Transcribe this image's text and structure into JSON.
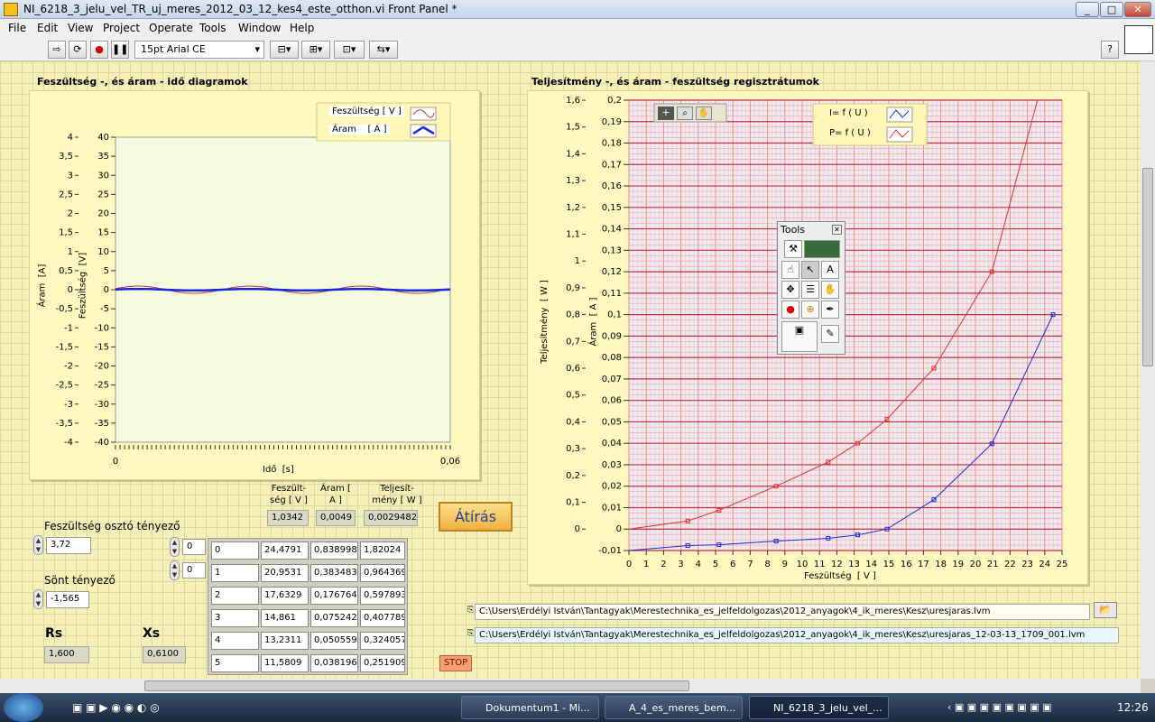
{
  "window": {
    "title": "NI_6218_3_jelu_vel_TR_uj_meres_2012_03_12_kes4_este_otthon.vi Front Panel *"
  },
  "menu": [
    "File",
    "Edit",
    "View",
    "Project",
    "Operate",
    "Tools",
    "Window",
    "Help"
  ],
  "toolbar": {
    "font": "15pt Arial CE",
    "help": "?"
  },
  "left_graph": {
    "title": "Feszültség -, és áram - idő diagramok",
    "legend": [
      "Feszültség [ V ]",
      "Áram    [ A ]"
    ],
    "y_left_label": "Áram  [A]",
    "y_right_label": "Feszültség  [V]",
    "x_label": "Idő  [s]",
    "y_left_ticks": [
      "4",
      "3,5",
      "3",
      "2,5",
      "2",
      "1,5",
      "1",
      "0,5",
      "0",
      "-0,5",
      "-1",
      "-1,5",
      "-2",
      "-2,5",
      "-3",
      "-3,5",
      "-4"
    ],
    "y_right_ticks": [
      "40",
      "35",
      "30",
      "25",
      "20",
      "15",
      "10",
      "5",
      "0",
      "-5",
      "-10",
      "-15",
      "-20",
      "-25",
      "-30",
      "-35",
      "-40"
    ],
    "x_ticks": [
      "0",
      "0,06"
    ]
  },
  "right_graph": {
    "title": "Teljesítmény -, és áram - feszültség regisztrátumok",
    "legend": [
      "I= f ( U )",
      "P= f ( U )"
    ],
    "y_left_label": "Teljesítmény  [ W ]",
    "y_right_label": "Áram  [ A ]",
    "x_label": "Feszültség  [ V ]",
    "p_ticks": [
      "1,6",
      "1,5",
      "1,4",
      "1,3",
      "1,2",
      "1,1",
      "1",
      "0,9",
      "0,8",
      "0,7",
      "0,6",
      "0,5",
      "0,4",
      "0,3",
      "0,2",
      "0,1",
      "0"
    ],
    "i_ticks": [
      "0,2",
      "0,19",
      "0,18",
      "0,17",
      "0,16",
      "0,15",
      "0,14",
      "0,13",
      "0,12",
      "0,11",
      "0,1",
      "0,09",
      "0,08",
      "0,07",
      "0,06",
      "0,05",
      "0,04",
      "0,03",
      "0,02",
      "0,01",
      "0",
      "-0,01"
    ],
    "x_ticks": [
      "0",
      "1",
      "2",
      "3",
      "4",
      "5",
      "6",
      "7",
      "8",
      "9",
      "10",
      "11",
      "12",
      "13",
      "14",
      "15",
      "16",
      "17",
      "18",
      "19",
      "20",
      "21",
      "22",
      "23",
      "24",
      "25"
    ]
  },
  "chart_data": {
    "type": "line",
    "title": "Teljesítmény -, és áram - feszültség regisztrátumok",
    "xlabel": "Feszültség  [ V ]",
    "ylabel": "Teljesítmény  [ W ]",
    "xlim": [
      0,
      25
    ],
    "series": [
      {
        "name": "I= f ( U )",
        "axis": "I",
        "color": "#1a2ad8",
        "x": [
          0,
          3.4,
          5.2,
          8.5,
          11.5,
          13.2,
          14.9,
          17.6,
          20.95,
          24.48
        ],
        "y": [
          -0.01,
          -0.0077,
          -0.0073,
          -0.0056,
          -0.0043,
          -0.0027,
          0.0,
          0.0137,
          0.0398,
          0.1
        ]
      },
      {
        "name": "P= f ( U )",
        "axis": "P",
        "color": "#e83030",
        "x": [
          0,
          3.4,
          5.2,
          8.5,
          11.5,
          13.2,
          14.9,
          17.6,
          20.95,
          24.48
        ],
        "y": [
          0.0,
          0.03,
          0.07,
          0.16,
          0.25,
          0.32,
          0.41,
          0.6,
          0.96,
          1.82
        ]
      }
    ],
    "ylim_P": [
      0,
      1.6
    ],
    "ylim_I": [
      -0.01,
      0.2
    ]
  },
  "readouts": {
    "h_u": "Feszült-\nség [ V ]",
    "h_i": "Áram [\nA ]",
    "h_p": "Teljesít-\nmény [ W ]",
    "u": "1,0342",
    "i": "0,0049",
    "p": "0,0029482",
    "button": "Átírás"
  },
  "controls": {
    "div_label": "Feszültség osztó tényező",
    "div_value": "3,72",
    "shunt_label": "Sönt tényező",
    "shunt_value": "-1,565",
    "rs_label": "Rs",
    "rs_value": "1,600",
    "xs_label": "Xs",
    "xs_value": "0,6100",
    "idx1": "0",
    "idx2": "0",
    "stop": "STOP"
  },
  "table": [
    [
      "0",
      "24,4791",
      "0,838998",
      "1,82024"
    ],
    [
      "1",
      "20,9531",
      "0,383483",
      "0,964369"
    ],
    [
      "2",
      "17,6329",
      "0,176764",
      "0,597893"
    ],
    [
      "3",
      "14,861",
      "0,075242",
      "0,407789"
    ],
    [
      "4",
      "13,2311",
      "0,050559",
      "0,324057"
    ],
    [
      "5",
      "11,5809",
      "0,038196",
      "0,251909"
    ]
  ],
  "paths": {
    "p1": "C:\\Users\\Erdélyi István\\Tantagyak\\Merestechnika_es_jelfeldolgozas\\2012_anyagok\\4_ik_meres\\Kesz\\uresjaras.lvm",
    "p2": "C:\\Users\\Erdélyi István\\Tantagyak\\Merestechnika_es_jelfeldolgozas\\2012_anyagok\\4_ik_meres\\Kesz\\uresjaras_12-03-13_1709_001.lvm"
  },
  "tools_palette": {
    "title": "Tools"
  },
  "taskbar": {
    "tasks": [
      "Dokumentum1 - Mi...",
      "A_4_es_meres_bem...",
      "NI_6218_3_jelu_vel_..."
    ],
    "clock": "12:26"
  }
}
